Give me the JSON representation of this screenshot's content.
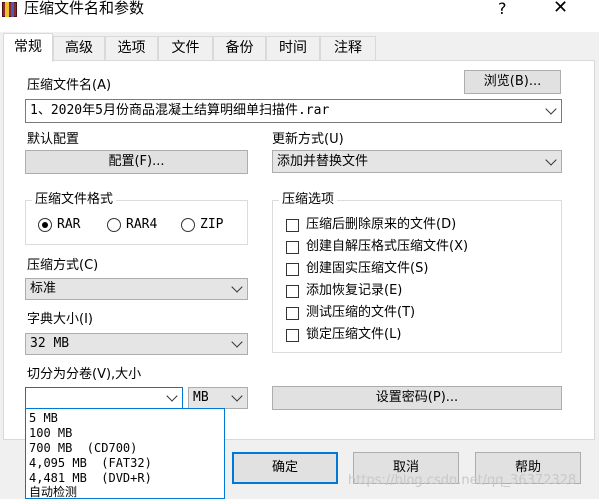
{
  "window": {
    "title": "压缩文件名和参数",
    "help_glyph": "?",
    "close_glyph": "✕"
  },
  "tabs": [
    {
      "label": "常规",
      "active": true
    },
    {
      "label": "高级"
    },
    {
      "label": "选项"
    },
    {
      "label": "文件"
    },
    {
      "label": "备份"
    },
    {
      "label": "时间"
    },
    {
      "label": "注释"
    }
  ],
  "archive": {
    "name_label": "压缩文件名(A)",
    "browse_label": "浏览(B)...",
    "name_value": "1、2020年5月份商品混凝土结算明细单扫描件.rar"
  },
  "profile": {
    "label": "默认配置",
    "button_label": "配置(F)..."
  },
  "update_mode": {
    "label": "更新方式(U)",
    "value": "添加并替换文件"
  },
  "format": {
    "title": "压缩文件格式",
    "options": [
      {
        "label": "RAR",
        "checked": true
      },
      {
        "label": "RAR4",
        "checked": false
      },
      {
        "label": "ZIP",
        "checked": false
      }
    ]
  },
  "compression_method": {
    "label": "压缩方式(C)",
    "value": "标准"
  },
  "dictionary": {
    "label": "字典大小(I)",
    "value": "32 MB"
  },
  "split": {
    "label": "切分为分卷(V),大小",
    "value": "",
    "unit": "MB",
    "options": [
      "5 MB",
      "100 MB",
      "700 MB  (CD700)",
      "4,095 MB  (FAT32)",
      "4,481 MB  (DVD+R)",
      "自动检测"
    ]
  },
  "archive_options": {
    "title": "压缩选项",
    "items": [
      {
        "label": "压缩后删除原来的文件(D)",
        "checked": false
      },
      {
        "label": "创建自解压格式压缩文件(X)",
        "checked": false
      },
      {
        "label": "创建固实压缩文件(S)",
        "checked": false
      },
      {
        "label": "添加恢复记录(E)",
        "checked": false
      },
      {
        "label": "测试压缩的文件(T)",
        "checked": false
      },
      {
        "label": "锁定压缩文件(L)",
        "checked": false
      }
    ]
  },
  "password_button_label": "设置密码(P)...",
  "footer": {
    "ok": "确定",
    "cancel": "取消",
    "help": "帮助"
  },
  "watermark": "https://blog.csdn.net/qq_36372328",
  "colors": {
    "accent": "#0078d7",
    "button_face": "#e1e1e1",
    "dialog_bg": "#f0f0f0"
  }
}
